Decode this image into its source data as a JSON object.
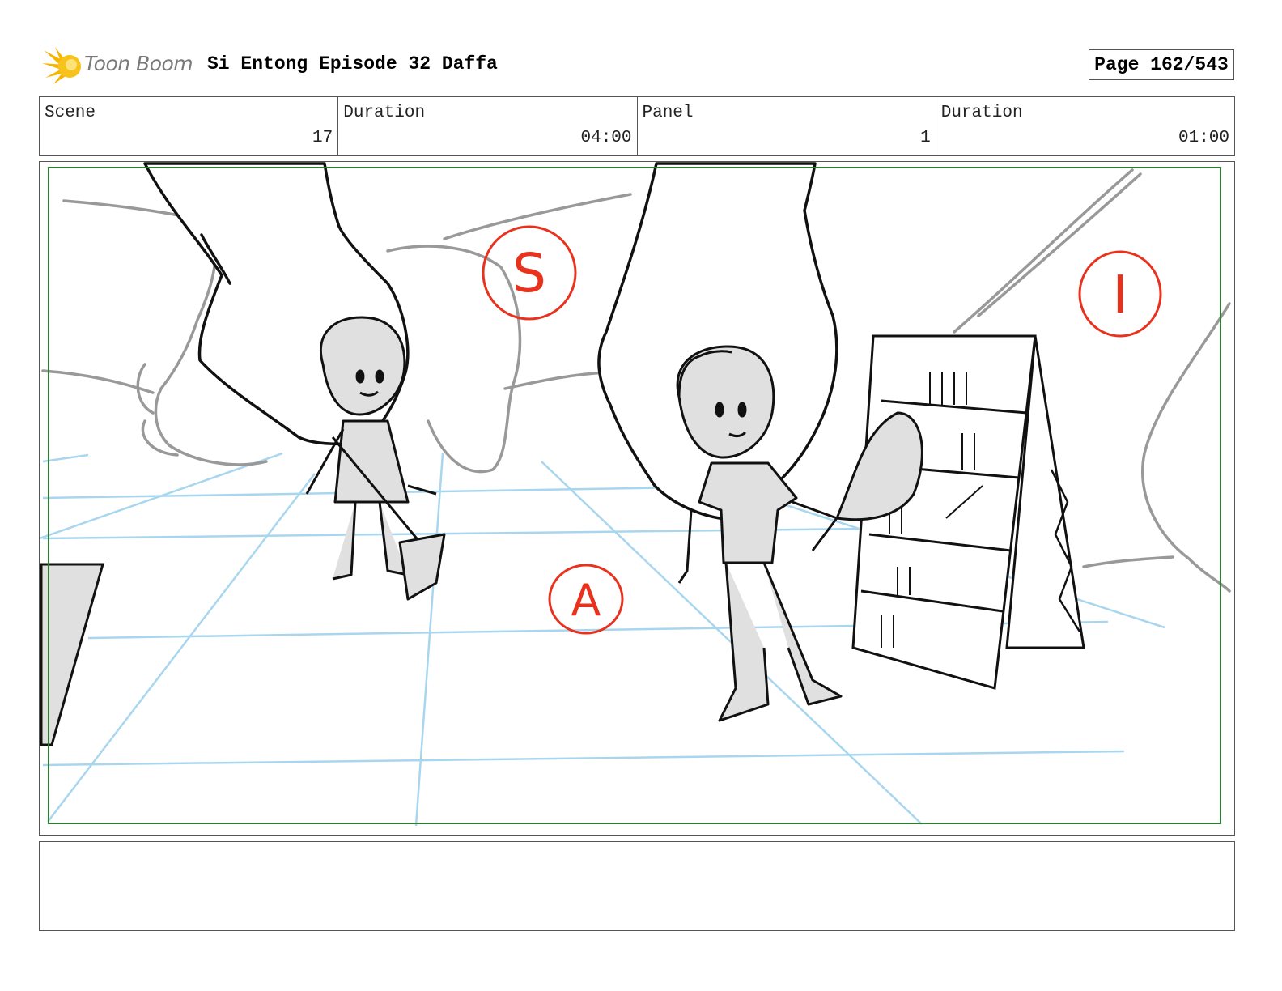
{
  "header": {
    "logo_text": "Toon Boom",
    "title": "Si Entong Episode 32 Daffa",
    "page_label": "Page 162/543"
  },
  "info": {
    "scene_label": "Scene",
    "scene_value": "17",
    "scene_duration_label": "Duration",
    "scene_duration_value": "04:00",
    "panel_label": "Panel",
    "panel_value": "1",
    "panel_duration_label": "Duration",
    "panel_duration_value": "01:00"
  },
  "panel": {
    "annotation_letters": [
      "S",
      "I",
      "A"
    ],
    "frame_color": "#2e7d32",
    "annotation_color": "#e8321e",
    "floor_grid_color": "#a9d6ef"
  },
  "notes": {
    "text": ""
  },
  "icons": {
    "logo": "toon-boom-starburst-icon"
  }
}
